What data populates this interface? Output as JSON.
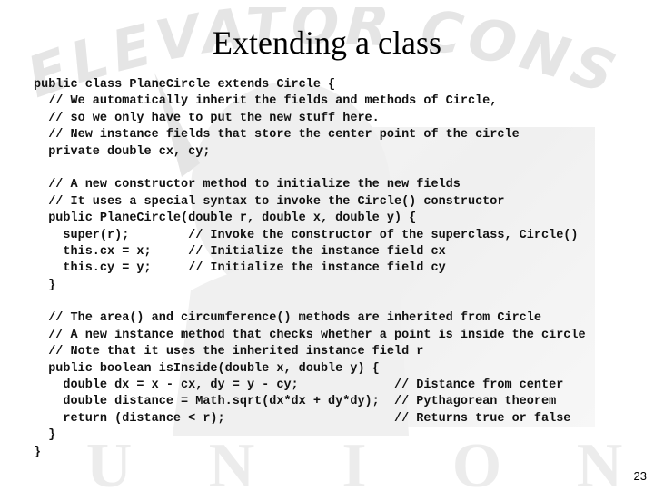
{
  "slide": {
    "title": "Extending a class",
    "page_number": "23",
    "watermark": {
      "top_text": "ELEVATOR CONSTRUCTORS",
      "bottom_letters": [
        "U",
        "N",
        "I",
        "O",
        "N"
      ]
    },
    "code_lines": [
      "public class PlaneCircle extends Circle {",
      "  // We automatically inherit the fields and methods of Circle,",
      "  // so we only have to put the new stuff here.",
      "  // New instance fields that store the center point of the circle",
      "  private double cx, cy;",
      "",
      "  // A new constructor method to initialize the new fields",
      "  // It uses a special syntax to invoke the Circle() constructor",
      "  public PlaneCircle(double r, double x, double y) {",
      "    super(r);        // Invoke the constructor of the superclass, Circle()",
      "    this.cx = x;     // Initialize the instance field cx",
      "    this.cy = y;     // Initialize the instance field cy",
      "  }",
      "",
      "  // The area() and circumference() methods are inherited from Circle",
      "  // A new instance method that checks whether a point is inside the circle",
      "  // Note that it uses the inherited instance field r",
      "  public boolean isInside(double x, double y) {",
      "    double dx = x - cx, dy = y - cy;             // Distance from center",
      "    double distance = Math.sqrt(dx*dx + dy*dy);  // Pythagorean theorem",
      "    return (distance < r);                       // Returns true or false",
      "  }",
      "}"
    ]
  }
}
